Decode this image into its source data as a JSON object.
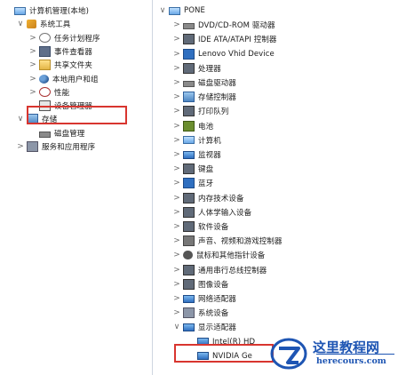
{
  "left_tree": [
    {
      "label": "计算机管理(本地)",
      "icon": "computer-management-icon",
      "twisty": "",
      "depth": 0
    },
    {
      "label": "系统工具",
      "icon": "system-tools-icon",
      "twisty": "∨",
      "depth": 1
    },
    {
      "label": "任务计划程序",
      "icon": "task-scheduler-icon",
      "twisty": ">",
      "depth": 2
    },
    {
      "label": "事件查看器",
      "icon": "event-viewer-icon",
      "twisty": ">",
      "depth": 2
    },
    {
      "label": "共享文件夹",
      "icon": "shared-folders-icon",
      "twisty": ">",
      "depth": 2
    },
    {
      "label": "本地用户和组",
      "icon": "local-users-icon",
      "twisty": ">",
      "depth": 2
    },
    {
      "label": "性能",
      "icon": "performance-icon",
      "twisty": ">",
      "depth": 2
    },
    {
      "label": "设备管理器",
      "icon": "device-manager-icon",
      "twisty": "",
      "depth": 2
    },
    {
      "label": "存储",
      "icon": "storage-icon",
      "twisty": "∨",
      "depth": 1
    },
    {
      "label": "磁盘管理",
      "icon": "disk-management-icon",
      "twisty": "",
      "depth": 2
    },
    {
      "label": "服务和应用程序",
      "icon": "services-apps-icon",
      "twisty": ">",
      "depth": 1
    }
  ],
  "right_tree": [
    {
      "label": "PONE",
      "icon": "computer-icon",
      "twisty": "∨",
      "depth": 0
    },
    {
      "label": "DVD/CD-ROM 驱动器",
      "icon": "dvd-drive-icon",
      "twisty": ">",
      "depth": 1
    },
    {
      "label": "IDE ATA/ATAPI 控制器",
      "icon": "ide-controller-icon",
      "twisty": ">",
      "depth": 1
    },
    {
      "label": "Lenovo Vhid Device",
      "icon": "lenovo-device-icon",
      "twisty": ">",
      "depth": 1
    },
    {
      "label": "处理器",
      "icon": "processor-icon",
      "twisty": ">",
      "depth": 1
    },
    {
      "label": "磁盘驱动器",
      "icon": "disk-drive-icon",
      "twisty": ">",
      "depth": 1
    },
    {
      "label": "存储控制器",
      "icon": "storage-controller-icon",
      "twisty": ">",
      "depth": 1
    },
    {
      "label": "打印队列",
      "icon": "print-queue-icon",
      "twisty": ">",
      "depth": 1
    },
    {
      "label": "电池",
      "icon": "battery-icon",
      "twisty": ">",
      "depth": 1
    },
    {
      "label": "计算机",
      "icon": "computer-icon",
      "twisty": ">",
      "depth": 1
    },
    {
      "label": "监视器",
      "icon": "monitor-icon",
      "twisty": ">",
      "depth": 1
    },
    {
      "label": "键盘",
      "icon": "keyboard-icon",
      "twisty": ">",
      "depth": 1
    },
    {
      "label": "蓝牙",
      "icon": "bluetooth-icon",
      "twisty": ">",
      "depth": 1
    },
    {
      "label": "内存技术设备",
      "icon": "memory-device-icon",
      "twisty": ">",
      "depth": 1
    },
    {
      "label": "人体学输入设备",
      "icon": "hid-icon",
      "twisty": ">",
      "depth": 1
    },
    {
      "label": "软件设备",
      "icon": "software-device-icon",
      "twisty": ">",
      "depth": 1
    },
    {
      "label": "声音、视频和游戏控制器",
      "icon": "sound-icon",
      "twisty": ">",
      "depth": 1
    },
    {
      "label": "鼠标和其他指针设备",
      "icon": "mouse-icon",
      "twisty": ">",
      "depth": 1
    },
    {
      "label": "通用串行总线控制器",
      "icon": "usb-icon",
      "twisty": ">",
      "depth": 1
    },
    {
      "label": "图像设备",
      "icon": "imaging-device-icon",
      "twisty": ">",
      "depth": 1
    },
    {
      "label": "网络适配器",
      "icon": "network-adapter-icon",
      "twisty": ">",
      "depth": 1
    },
    {
      "label": "系统设备",
      "icon": "system-device-icon",
      "twisty": ">",
      "depth": 1
    },
    {
      "label": "显示适配器",
      "icon": "display-adapter-icon",
      "twisty": "∨",
      "depth": 1
    },
    {
      "label": "Intel(R) HD",
      "icon": "display-adapter-icon",
      "twisty": "",
      "depth": 2
    },
    {
      "label": "NVIDIA Ge",
      "icon": "display-adapter-icon",
      "twisty": "",
      "depth": 2
    }
  ],
  "highlight_color": "#d8352f",
  "watermark": {
    "title": "这里教程网",
    "url": "herecours.com"
  }
}
